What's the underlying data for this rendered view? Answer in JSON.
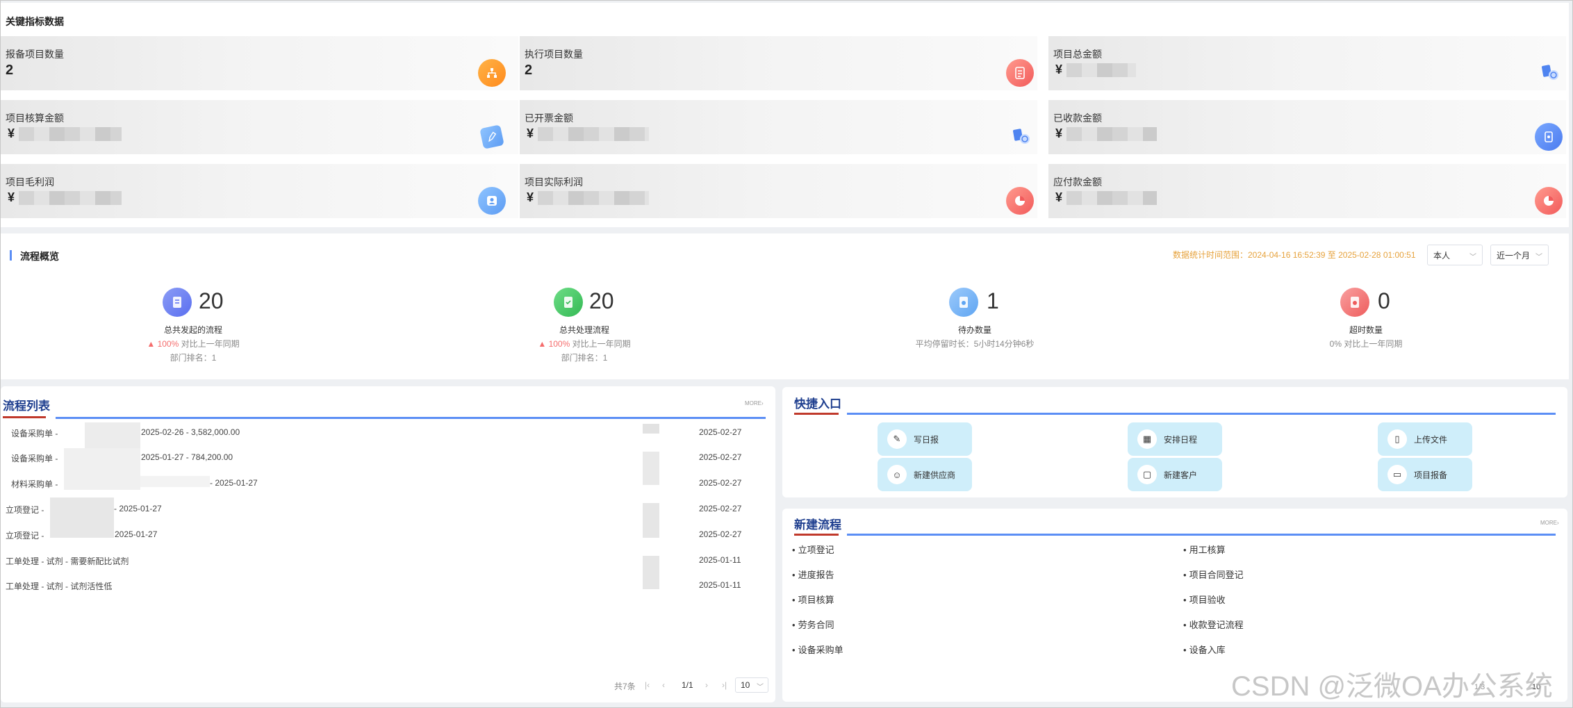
{
  "kpi": {
    "title": "关键指标数据",
    "cards": [
      {
        "label": "报备项目数量",
        "value": "2",
        "icon": "sitemap-icon"
      },
      {
        "label": "执行项目数量",
        "value": "2",
        "icon": "document-icon"
      },
      {
        "label": "项目总金额",
        "currency": "¥",
        "icon": "coin-person-icon"
      },
      {
        "label": "项目核算金额",
        "currency": "¥",
        "icon": "edit-doc-icon"
      },
      {
        "label": "已开票金额",
        "currency": "¥",
        "icon": "coin-person-icon"
      },
      {
        "label": "已收款金额",
        "currency": "¥",
        "icon": "wallet-icon"
      },
      {
        "label": "项目毛利润",
        "currency": "¥",
        "icon": "user-card-icon"
      },
      {
        "label": "项目实际利润",
        "currency": "¥",
        "icon": "pie-icon"
      },
      {
        "label": "应付款金额",
        "currency": "¥",
        "icon": "pie-icon"
      }
    ]
  },
  "flow": {
    "title": "流程概览",
    "range": "数据统计时间范围：2024-04-16 16:52:39 至 2025-02-28 01:00:51",
    "scope_select": "本人",
    "period_select": "近一个月",
    "stats": [
      {
        "num": "20",
        "label": "总共发起的流程",
        "pct": "100%",
        "compare": "对比上一年同期",
        "rank": "部门排名：1",
        "color": "#6f86f0"
      },
      {
        "num": "20",
        "label": "总共处理流程",
        "pct": "100%",
        "compare": "对比上一年同期",
        "rank": "部门排名：1",
        "color": "#4cc765"
      },
      {
        "num": "1",
        "label": "待办数量",
        "sub": "平均停留时长：5小时14分钟6秒",
        "color": "#6fb0f7"
      },
      {
        "num": "0",
        "label": "超时数量",
        "sub": "0% 对比上一年同期",
        "color": "#f26d6d"
      }
    ]
  },
  "list": {
    "title": "流程列表",
    "more": "MORE›",
    "rows": [
      {
        "text": "设备采购单 -",
        "tail": "2025-02-26 -  3,582,000.00",
        "date": "2025-02-27"
      },
      {
        "text": "设备采购单 -",
        "tail": "2025-01-27 -  784,200.00",
        "date": "2025-02-27"
      },
      {
        "text": "材料采购单 -",
        "tail": "-    2025-01-27",
        "date": "2025-02-27"
      },
      {
        "text": "立项登记 -",
        "tail": "- 2025-01-27",
        "date": "2025-02-27"
      },
      {
        "text": "立项登记 -",
        "tail": "2025-01-27",
        "date": "2025-02-27"
      },
      {
        "text": "工单处理 - 试剂 - 需要新配比试剂",
        "tail": "",
        "date": "2025-01-11"
      },
      {
        "text": "工单处理 - 试剂 - 试剂活性低",
        "tail": "",
        "date": "2025-01-11"
      }
    ],
    "pager": {
      "total": "共7条",
      "page": "1/1",
      "size": "10"
    }
  },
  "quick": {
    "title": "快捷入口",
    "buttons": [
      {
        "label": "写日报",
        "icon": "report-icon"
      },
      {
        "label": "安排日程",
        "icon": "calendar-icon"
      },
      {
        "label": "上传文件",
        "icon": "file-icon"
      },
      {
        "label": "新建供应商",
        "icon": "user-add-icon"
      },
      {
        "label": "新建客户",
        "icon": "contact-icon"
      },
      {
        "label": "项目报备",
        "icon": "chat-icon"
      }
    ]
  },
  "new_flow": {
    "title": "新建流程",
    "more": "MORE›",
    "left": [
      "立项登记",
      "进度报告",
      "项目核算",
      "劳务合同",
      "设备采购单"
    ],
    "right": [
      "用工核算",
      "项目合同登记",
      "项目验收",
      "收款登记流程",
      "设备入库"
    ],
    "pager_page": "1/3",
    "pager_size": "10"
  },
  "watermark": "CSDN @泛微OA办公系统"
}
